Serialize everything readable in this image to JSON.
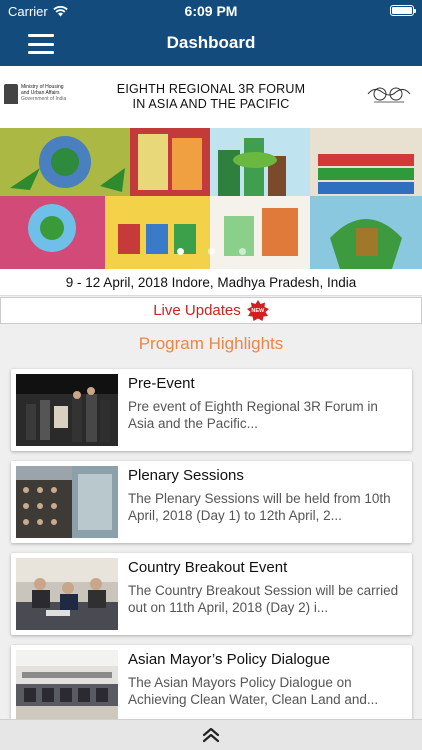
{
  "status_bar": {
    "carrier": "Carrier",
    "time": "6:09 PM",
    "wifi_icon": "wifi-icon",
    "battery_icon": "battery-icon"
  },
  "nav": {
    "title": "Dashboard",
    "menu_icon": "hamburger-menu-icon"
  },
  "forum": {
    "ministry_line1": "Ministry of Housing",
    "ministry_line2": "and Urban Affairs",
    "ministry_line3": "Government of India",
    "title_line1": "EIGHTH REGIONAL 3R FORUM",
    "title_line2": "IN ASIA AND THE PACIFIC"
  },
  "banner": {
    "slides": 3,
    "active_slide": 0
  },
  "event_date": "9 - 12 April, 2018 Indore, Madhya Pradesh, India",
  "live_updates": {
    "label": "Live Updates",
    "badge": "NEW"
  },
  "program": {
    "heading": "Program Highlights",
    "items": [
      {
        "title": "Pre-Event",
        "description": "Pre event of Eighth Regional 3R Forum in Asia and the Pacific..."
      },
      {
        "title": "Plenary Sessions",
        "description": "The Plenary Sessions will be held from 10th April, 2018 (Day 1) to 12th April, 2..."
      },
      {
        "title": "Country Breakout Event",
        "description": "The Country Breakout Session will be carried out on 11th April, 2018 (Day 2) i..."
      },
      {
        "title": "Asian Mayor’s Policy Dialogue",
        "description": "The Asian Mayors Policy Dialogue on Achieving Clean Water, Clean Land and..."
      }
    ]
  },
  "bottom_bar": {
    "icon": "double-chevron-up-icon"
  },
  "colors": {
    "nav_bg": "#134b7d",
    "accent_orange": "#e8874a",
    "live_red": "#d31f1f"
  }
}
